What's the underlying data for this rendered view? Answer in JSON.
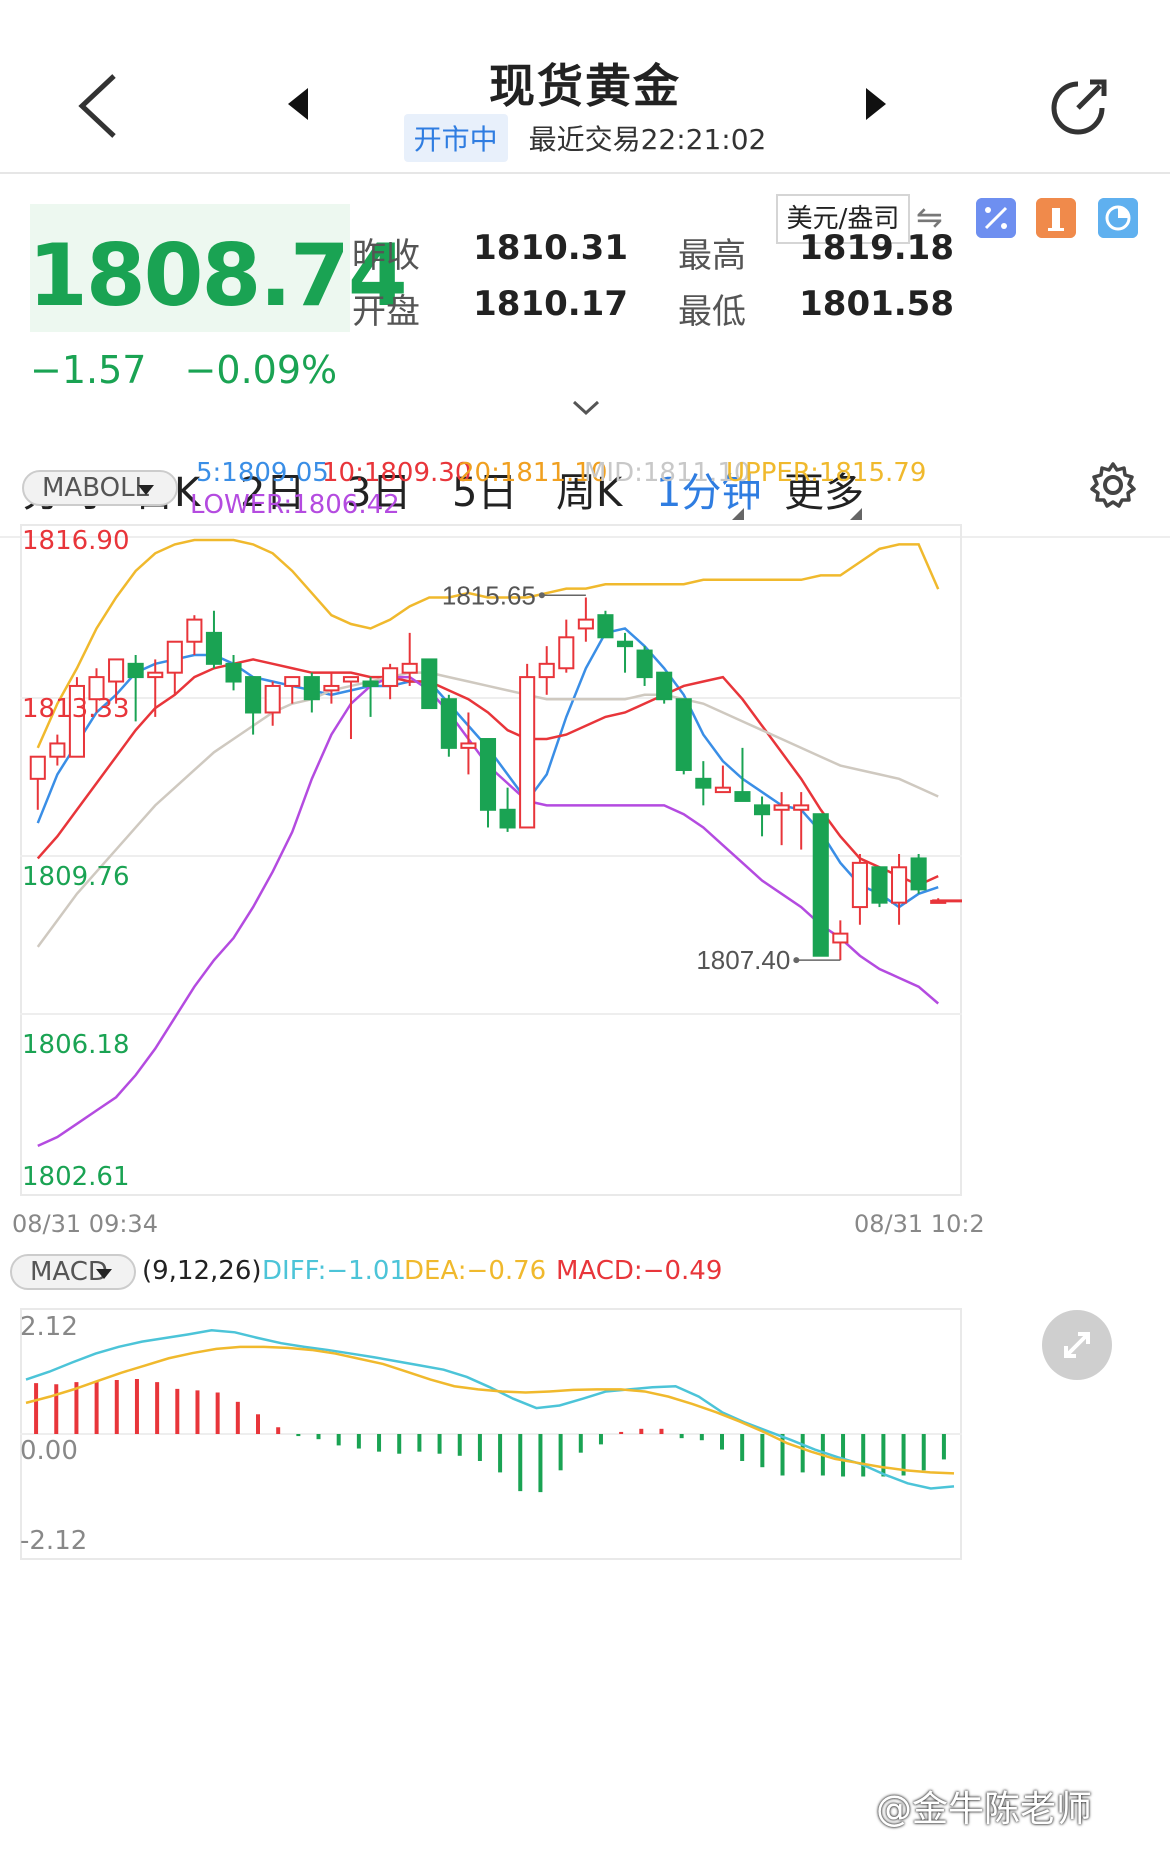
{
  "header": {
    "title": "现货黄金",
    "status": "开市中",
    "last_trade": "最近交易22:21:02"
  },
  "quote": {
    "price": "1808.74",
    "change": "−1.57",
    "change_pct": "−0.09%",
    "unit": "美元/盎司",
    "prev_close_label": "昨收",
    "prev_close": "1810.31",
    "open_label": "开盘",
    "open": "1810.17",
    "high_label": "最高",
    "high": "1819.18",
    "low_label": "最低",
    "low": "1801.58",
    "up_color": "#e8353a",
    "down_color": "#1aa353"
  },
  "tabs": [
    {
      "label": "分时"
    },
    {
      "label": "日K"
    },
    {
      "label": "2日"
    },
    {
      "label": "3日"
    },
    {
      "label": "5日"
    },
    {
      "label": "周K"
    },
    {
      "label": "1分钟"
    },
    {
      "label": "更多"
    }
  ],
  "main_indicator": {
    "name": "MABOLL",
    "ma5": "5:1809.05",
    "ma10": "10:1809.30",
    "ma20": "20:1811.10",
    "mid": "MID:1811.10",
    "upper": "UPPER:1815.79",
    "lower": "LOWER:1806.42",
    "colors": {
      "ma5": "#3a8ee6",
      "ma10": "#e8353a",
      "ma20": "#f0a020",
      "mid": "#c8c8c8",
      "upper": "#f0b92d",
      "lower": "#b44be0"
    }
  },
  "sub_indicator": {
    "name": "MACD",
    "params": "(9,12,26)",
    "diff": "DIFF:−1.01",
    "dea": "DEA:−0.76",
    "macd": "MACD:−0.49"
  },
  "time_axis": {
    "start": "08/31 09:34",
    "end": "08/31 10:2"
  },
  "watermark": "@金牛陈老师",
  "chart_data": [
    {
      "type": "candlestick",
      "title": "",
      "y_ticks": [
        "1816.90",
        "1813.33",
        "1809.76",
        "1806.18",
        "1802.61"
      ],
      "ylim": [
        1802.61,
        1816.9
      ],
      "annotations": [
        {
          "text": "1815.65",
          "x": 28,
          "y": 1815.65
        },
        {
          "text": "1807.40",
          "x": 41,
          "y": 1807.4
        }
      ],
      "candles": [
        {
          "o": 1811.5,
          "h": 1812.0,
          "l": 1810.8,
          "c": 1812.0
        },
        {
          "o": 1812.0,
          "h": 1812.5,
          "l": 1811.8,
          "c": 1812.3
        },
        {
          "o": 1812.0,
          "h": 1813.8,
          "l": 1812.0,
          "c": 1813.6
        },
        {
          "o": 1813.3,
          "h": 1814.0,
          "l": 1813.0,
          "c": 1813.8
        },
        {
          "o": 1813.7,
          "h": 1814.1,
          "l": 1813.2,
          "c": 1814.2
        },
        {
          "o": 1814.1,
          "h": 1814.3,
          "l": 1812.8,
          "c": 1813.8
        },
        {
          "o": 1813.8,
          "h": 1814.2,
          "l": 1812.9,
          "c": 1813.9
        },
        {
          "o": 1813.9,
          "h": 1814.6,
          "l": 1813.4,
          "c": 1814.6
        },
        {
          "o": 1814.6,
          "h": 1815.2,
          "l": 1814.3,
          "c": 1815.1
        },
        {
          "o": 1814.8,
          "h": 1815.3,
          "l": 1814.0,
          "c": 1814.1
        },
        {
          "o": 1814.1,
          "h": 1814.3,
          "l": 1813.5,
          "c": 1813.7
        },
        {
          "o": 1813.8,
          "h": 1813.8,
          "l": 1812.5,
          "c": 1813.0
        },
        {
          "o": 1813.0,
          "h": 1813.7,
          "l": 1812.7,
          "c": 1813.6
        },
        {
          "o": 1813.6,
          "h": 1813.8,
          "l": 1813.2,
          "c": 1813.8
        },
        {
          "o": 1813.8,
          "h": 1813.9,
          "l": 1813.0,
          "c": 1813.3
        },
        {
          "o": 1813.5,
          "h": 1813.9,
          "l": 1813.2,
          "c": 1813.6
        },
        {
          "o": 1813.7,
          "h": 1813.8,
          "l": 1812.4,
          "c": 1813.8
        },
        {
          "o": 1813.7,
          "h": 1813.8,
          "l": 1812.9,
          "c": 1813.6
        },
        {
          "o": 1813.6,
          "h": 1814.1,
          "l": 1813.3,
          "c": 1814.0
        },
        {
          "o": 1813.9,
          "h": 1814.8,
          "l": 1813.6,
          "c": 1814.1
        },
        {
          "o": 1814.2,
          "h": 1814.2,
          "l": 1813.1,
          "c": 1813.1
        },
        {
          "o": 1813.3,
          "h": 1813.4,
          "l": 1812.0,
          "c": 1812.2
        },
        {
          "o": 1812.2,
          "h": 1813.0,
          "l": 1811.6,
          "c": 1812.3
        },
        {
          "o": 1812.4,
          "h": 1812.4,
          "l": 1810.4,
          "c": 1810.8
        },
        {
          "o": 1810.8,
          "h": 1811.3,
          "l": 1810.3,
          "c": 1810.4
        },
        {
          "o": 1810.4,
          "h": 1814.1,
          "l": 1810.4,
          "c": 1813.8
        },
        {
          "o": 1813.8,
          "h": 1814.5,
          "l": 1813.4,
          "c": 1814.1
        },
        {
          "o": 1814.0,
          "h": 1815.1,
          "l": 1813.9,
          "c": 1814.7
        },
        {
          "o": 1814.9,
          "h": 1815.6,
          "l": 1814.6,
          "c": 1815.1
        },
        {
          "o": 1815.2,
          "h": 1815.3,
          "l": 1814.7,
          "c": 1814.7
        },
        {
          "o": 1814.6,
          "h": 1814.8,
          "l": 1813.9,
          "c": 1814.5
        },
        {
          "o": 1814.4,
          "h": 1814.5,
          "l": 1813.6,
          "c": 1813.8
        },
        {
          "o": 1813.9,
          "h": 1813.9,
          "l": 1813.2,
          "c": 1813.3
        },
        {
          "o": 1813.3,
          "h": 1813.3,
          "l": 1811.6,
          "c": 1811.7
        },
        {
          "o": 1811.5,
          "h": 1811.9,
          "l": 1810.9,
          "c": 1811.3
        },
        {
          "o": 1811.2,
          "h": 1811.8,
          "l": 1811.2,
          "c": 1811.3
        },
        {
          "o": 1811.2,
          "h": 1812.2,
          "l": 1811.0,
          "c": 1811.0
        },
        {
          "o": 1810.9,
          "h": 1811.1,
          "l": 1810.2,
          "c": 1810.7
        },
        {
          "o": 1810.8,
          "h": 1811.2,
          "l": 1810.0,
          "c": 1810.9
        },
        {
          "o": 1810.8,
          "h": 1811.2,
          "l": 1809.9,
          "c": 1810.9
        },
        {
          "o": 1810.7,
          "h": 1810.7,
          "l": 1807.5,
          "c": 1807.5
        },
        {
          "o": 1807.8,
          "h": 1808.3,
          "l": 1807.4,
          "c": 1808.0
        },
        {
          "o": 1808.6,
          "h": 1809.8,
          "l": 1808.2,
          "c": 1809.6
        },
        {
          "o": 1809.5,
          "h": 1809.5,
          "l": 1808.6,
          "c": 1808.7
        },
        {
          "o": 1808.7,
          "h": 1809.8,
          "l": 1808.2,
          "c": 1809.5
        },
        {
          "o": 1809.7,
          "h": 1809.8,
          "l": 1808.9,
          "c": 1809.0
        },
        {
          "o": 1808.7,
          "h": 1808.8,
          "l": 1808.7,
          "c": 1808.74
        }
      ],
      "series": [
        {
          "name": "5",
          "values": [
            1810.5,
            1811.6,
            1812.3,
            1813.0,
            1813.4,
            1813.9,
            1814.1,
            1814.2,
            1814.3,
            1814.3,
            1814.1,
            1813.8,
            1813.7,
            1813.6,
            1813.5,
            1813.4,
            1813.5,
            1813.6,
            1813.6,
            1813.7,
            1813.7,
            1813.2,
            1812.7,
            1812.2,
            1811.6,
            1811.0,
            1811.6,
            1812.9,
            1814.0,
            1814.8,
            1814.9,
            1814.5,
            1814.0,
            1813.4,
            1812.5,
            1811.9,
            1811.5,
            1811.2,
            1810.9,
            1810.8,
            1810.3,
            1809.6,
            1809.1,
            1808.9,
            1808.6,
            1808.9,
            1809.05
          ]
        },
        {
          "name": "10",
          "values": [
            1809.7,
            1810.2,
            1810.8,
            1811.4,
            1812.0,
            1812.6,
            1813.1,
            1813.4,
            1813.8,
            1814.0,
            1814.1,
            1814.2,
            1814.1,
            1814.0,
            1813.9,
            1813.9,
            1813.9,
            1813.8,
            1813.8,
            1813.7,
            1813.7,
            1813.5,
            1813.3,
            1813.0,
            1812.6,
            1812.4,
            1812.4,
            1812.5,
            1812.7,
            1812.9,
            1813.0,
            1813.2,
            1813.4,
            1813.6,
            1813.7,
            1813.8,
            1813.3,
            1812.7,
            1812.1,
            1811.5,
            1810.8,
            1810.2,
            1809.7,
            1809.5,
            1809.3,
            1809.1,
            1809.3
          ]
        },
        {
          "name": "MID",
          "values": [
            1807.7,
            1808.3,
            1808.9,
            1809.4,
            1809.9,
            1810.4,
            1810.9,
            1811.3,
            1811.7,
            1812.1,
            1812.4,
            1812.7,
            1813.0,
            1813.2,
            1813.3,
            1813.5,
            1813.6,
            1813.7,
            1813.8,
            1813.9,
            1813.9,
            1813.8,
            1813.7,
            1813.6,
            1813.5,
            1813.4,
            1813.3,
            1813.3,
            1813.3,
            1813.3,
            1813.3,
            1813.4,
            1813.4,
            1813.3,
            1813.2,
            1813.0,
            1812.8,
            1812.6,
            1812.4,
            1812.2,
            1812.0,
            1811.8,
            1811.7,
            1811.6,
            1811.5,
            1811.3,
            1811.1
          ]
        },
        {
          "name": "UPPER",
          "values": [
            1812.2,
            1813.2,
            1814.0,
            1814.9,
            1815.6,
            1816.2,
            1816.6,
            1816.8,
            1816.9,
            1816.9,
            1816.9,
            1816.8,
            1816.6,
            1816.2,
            1815.7,
            1815.2,
            1815.0,
            1814.9,
            1815.1,
            1815.4,
            1815.6,
            1815.6,
            1815.7,
            1815.6,
            1815.6,
            1815.6,
            1815.7,
            1815.8,
            1815.8,
            1815.9,
            1815.9,
            1815.9,
            1815.9,
            1815.9,
            1816.0,
            1816.0,
            1816.0,
            1816.0,
            1816.0,
            1816.0,
            1816.1,
            1816.1,
            1816.4,
            1816.7,
            1816.8,
            1816.8,
            1815.79
          ]
        },
        {
          "name": "LOWER",
          "values": [
            1803.2,
            1803.4,
            1803.7,
            1804.0,
            1804.3,
            1804.8,
            1805.4,
            1806.1,
            1806.8,
            1807.4,
            1807.9,
            1808.6,
            1809.4,
            1810.3,
            1811.5,
            1812.5,
            1813.2,
            1813.6,
            1813.8,
            1813.8,
            1813.5,
            1813.0,
            1812.4,
            1811.8,
            1811.4,
            1811.0,
            1810.9,
            1810.9,
            1810.9,
            1810.9,
            1810.9,
            1810.9,
            1810.9,
            1810.7,
            1810.4,
            1810.0,
            1809.6,
            1809.2,
            1808.9,
            1808.6,
            1808.2,
            1807.9,
            1807.5,
            1807.2,
            1807.0,
            1806.8,
            1806.42
          ]
        }
      ]
    },
    {
      "type": "bar",
      "title": "",
      "y_ticks": [
        "2.12",
        "0.00",
        "-2.12"
      ],
      "ylim": [
        -2.12,
        2.12
      ],
      "bars": [
        0.98,
        0.96,
        1.0,
        1.02,
        1.04,
        1.06,
        1.0,
        0.87,
        0.84,
        0.8,
        0.62,
        0.38,
        0.13,
        -0.04,
        -0.1,
        -0.22,
        -0.28,
        -0.34,
        -0.38,
        -0.34,
        -0.38,
        -0.42,
        -0.52,
        -0.74,
        -1.1,
        -1.12,
        -0.7,
        -0.36,
        -0.2,
        0.04,
        0.1,
        0.1,
        -0.08,
        -0.12,
        -0.3,
        -0.52,
        -0.64,
        -0.8,
        -0.74,
        -0.8,
        -0.82,
        -0.82,
        -0.82,
        -0.8,
        -0.7,
        -0.49
      ],
      "series": [
        {
          "name": "DIFF",
          "values": [
            1.05,
            1.2,
            1.38,
            1.55,
            1.68,
            1.78,
            1.85,
            1.92,
            2.0,
            1.96,
            1.85,
            1.75,
            1.68,
            1.62,
            1.55,
            1.48,
            1.4,
            1.32,
            1.24,
            1.1,
            0.9,
            0.68,
            0.5,
            0.55,
            0.68,
            0.82,
            0.86,
            0.9,
            0.92,
            0.72,
            0.42,
            0.22,
            0.05,
            -0.12,
            -0.3,
            -0.45,
            -0.58,
            -0.78,
            -0.95,
            -1.05,
            -1.01
          ]
        },
        {
          "name": "DEA",
          "values": [
            0.6,
            0.72,
            0.86,
            1.02,
            1.18,
            1.32,
            1.46,
            1.56,
            1.64,
            1.68,
            1.68,
            1.66,
            1.62,
            1.55,
            1.45,
            1.35,
            1.2,
            1.05,
            0.92,
            0.86,
            0.82,
            0.8,
            0.82,
            0.85,
            0.86,
            0.86,
            0.82,
            0.72,
            0.58,
            0.42,
            0.24,
            0.04,
            -0.18,
            -0.34,
            -0.48,
            -0.56,
            -0.64,
            -0.7,
            -0.74,
            -0.76
          ]
        }
      ]
    }
  ]
}
